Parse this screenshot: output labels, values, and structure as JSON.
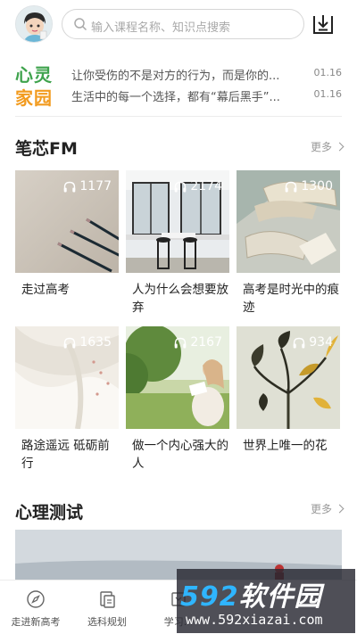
{
  "search": {
    "placeholder": "输入课程名称、知识点搜索"
  },
  "news": {
    "logo_line1": "心灵",
    "logo_line2": "家园",
    "items": [
      {
        "title": "让你受伤的不是对方的行为，而是你的...",
        "date": "01.16"
      },
      {
        "title": "生活中的每一个选择，都有“幕后黑手”...",
        "date": "01.16"
      }
    ]
  },
  "fm": {
    "title": "笔芯FM",
    "more": "更多",
    "cards": [
      {
        "caption": "走过高考",
        "listens": "1177"
      },
      {
        "caption": "人为什么会想要放弃",
        "listens": "2174"
      },
      {
        "caption": "高考是时光中的痕迹",
        "listens": "1300"
      },
      {
        "caption": "路途遥远 砥砺前行",
        "listens": "1635"
      },
      {
        "caption": "做一个内心强大的人",
        "listens": "2167"
      },
      {
        "caption": "世界上唯一的花",
        "listens": "934"
      }
    ]
  },
  "test": {
    "title": "心理测试",
    "more": "更多"
  },
  "tabs": [
    {
      "label": "走进新高考",
      "icon": "compass-icon"
    },
    {
      "label": "选科规划",
      "icon": "planning-icon"
    },
    {
      "label": "学习...",
      "icon": "study-icon"
    }
  ],
  "watermark": {
    "brand_num": "592",
    "brand_text": "软件园",
    "url": "www.592xiazai.com"
  },
  "colors": {
    "logo_green": "#3fa34d",
    "logo_orange": "#f29b1f",
    "watermark_blue": "#2fb5ff"
  }
}
